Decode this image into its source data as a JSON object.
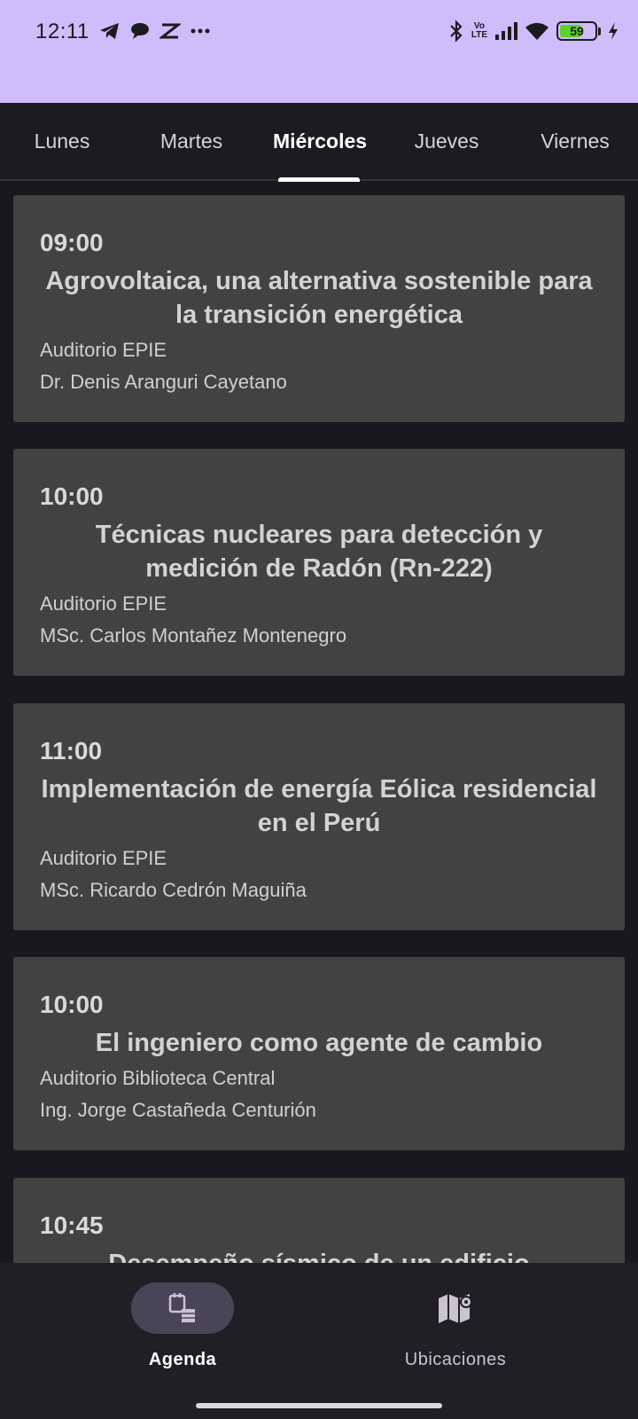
{
  "status_bar": {
    "time": "12:11",
    "left_icons": [
      "telegram-icon",
      "chat-bubble-icon",
      "capcut-icon",
      "more-dots-icon"
    ],
    "right_icons": [
      "bluetooth-icon",
      "volte-icon",
      "signal-icon",
      "wifi-icon",
      "battery-icon",
      "charging-icon"
    ],
    "volte_label_top": "Vo",
    "volte_label_bottom": "LTE",
    "battery_level": "59",
    "background_color": "#cfbcfb"
  },
  "tabs": {
    "items": [
      {
        "label": "Lunes"
      },
      {
        "label": "Martes"
      },
      {
        "label": "Miércoles"
      },
      {
        "label": "Jueves"
      },
      {
        "label": "Viernes"
      }
    ],
    "active": "Miércoles"
  },
  "sessions": [
    {
      "time": "09:00",
      "title": "Agrovoltaica, una alternativa sostenible para la transición energética",
      "room": "Auditorio EPIE",
      "speaker": "Dr. Denis Aranguri Cayetano"
    },
    {
      "time": "10:00",
      "title": "Técnicas nucleares para detección y medición de Radón (Rn-222)",
      "room": "Auditorio EPIE",
      "speaker": "MSc. Carlos Montañez Montenegro"
    },
    {
      "time": "11:00",
      "title": "Implementación de energía Eólica residencial en el Perú",
      "room": "Auditorio EPIE",
      "speaker": "MSc. Ricardo Cedrón Maguiña"
    },
    {
      "time": "10:00",
      "title": "El ingeniero como agente de cambio",
      "room": "Auditorio Biblioteca Central",
      "speaker": "Ing. Jorge Castañeda Centurión"
    },
    {
      "time": "10:45",
      "title": "Desempeño sísmico de un edificio",
      "room": "",
      "speaker": ""
    }
  ],
  "bottom_nav": {
    "items": [
      {
        "label": "Agenda",
        "icon": "agenda-icon",
        "active": true
      },
      {
        "label": "Ubicaciones",
        "icon": "map-icon",
        "active": false
      }
    ]
  },
  "colors": {
    "card": "#424242",
    "background": "#1a171e",
    "accent_pill": "#4a4458"
  }
}
